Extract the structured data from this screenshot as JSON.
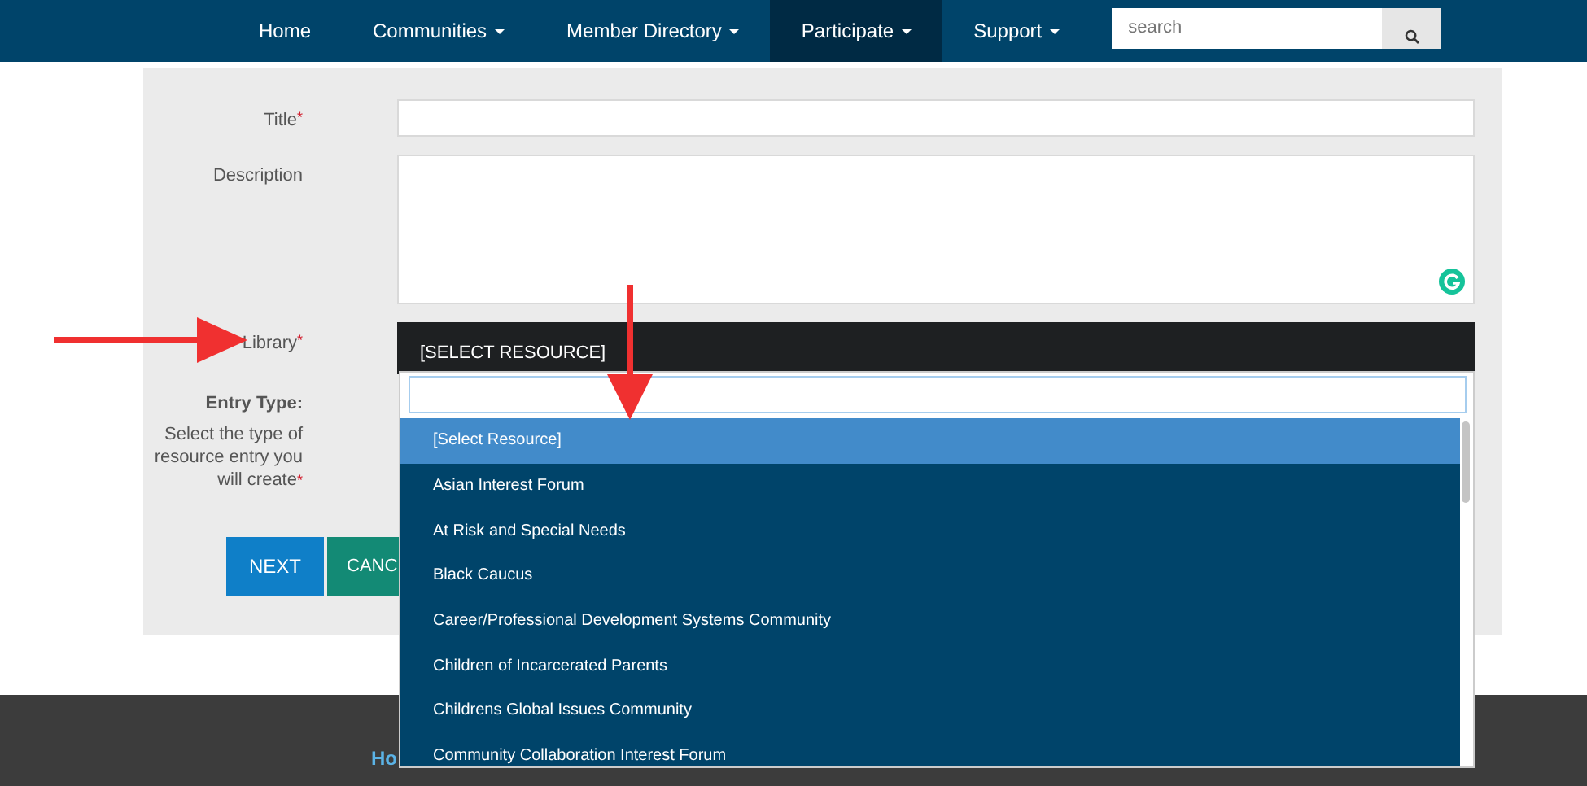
{
  "navbar": {
    "items": [
      {
        "label": "Home",
        "caret": false,
        "selected": false
      },
      {
        "label": "Communities",
        "caret": true,
        "selected": false
      },
      {
        "label": "Member Directory",
        "caret": true,
        "selected": false
      },
      {
        "label": "Participate",
        "caret": true,
        "selected": true
      },
      {
        "label": "Support",
        "caret": true,
        "selected": false
      }
    ],
    "search": {
      "placeholder": "search"
    }
  },
  "form": {
    "fields": [
      {
        "kind": "text",
        "label": "Title",
        "required_mark": "*"
      },
      {
        "kind": "textarea",
        "label": "Description"
      },
      {
        "kind": "select",
        "label": "Library",
        "required_mark": "*",
        "value": "[SELECT RESOURCE]"
      },
      {
        "kind": "note",
        "title": "Entry Type:",
        "label": "Select the type of resource entry you will create",
        "required_mark": "*"
      }
    ],
    "buttons": [
      {
        "label": "NEXT",
        "kind": "primary"
      },
      {
        "label": "CANC",
        "kind": "secondary"
      }
    ]
  },
  "dropdown": {
    "options": [
      {
        "label": "[Select Resource]",
        "selected": true
      },
      {
        "label": "Asian Interest Forum",
        "selected": false
      },
      {
        "label": "At Risk and Special Needs",
        "selected": false
      },
      {
        "label": "Black Caucus",
        "selected": false
      },
      {
        "label": "Career/Professional Development Systems Community",
        "selected": false
      },
      {
        "label": "Children of Incarcerated Parents",
        "selected": false
      },
      {
        "label": "Childrens Global Issues Community",
        "selected": false
      },
      {
        "label": "Community Collaboration Interest Forum",
        "selected": false
      }
    ]
  },
  "footer": {
    "link": "Ho"
  }
}
